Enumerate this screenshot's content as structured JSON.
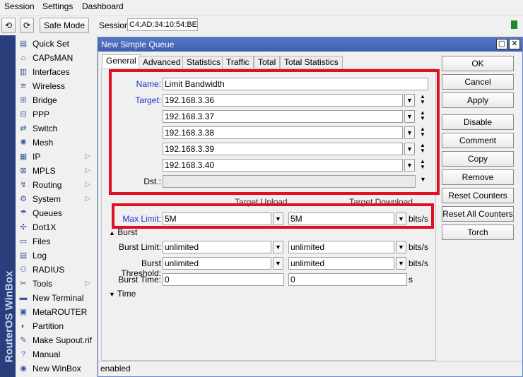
{
  "menubar": {
    "items": [
      "Session",
      "Settings",
      "Dashboard"
    ]
  },
  "toolbar": {
    "undo": "⟲",
    "redo": "⟳",
    "safe_mode": "Safe Mode",
    "session_label": "Session:",
    "session_value": "C4:AD:34:10:54:BE"
  },
  "brand": "RouterOS WinBox",
  "sidebar": {
    "items": [
      {
        "label": "Quick Set",
        "icon": "quick-set-icon"
      },
      {
        "label": "CAPsMAN",
        "icon": "capsman-icon"
      },
      {
        "label": "Interfaces",
        "icon": "interfaces-icon"
      },
      {
        "label": "Wireless",
        "icon": "wireless-icon"
      },
      {
        "label": "Bridge",
        "icon": "bridge-icon"
      },
      {
        "label": "PPP",
        "icon": "ppp-icon"
      },
      {
        "label": "Switch",
        "icon": "switch-icon"
      },
      {
        "label": "Mesh",
        "icon": "mesh-icon"
      },
      {
        "label": "IP",
        "icon": "ip-icon",
        "submenu": true
      },
      {
        "label": "MPLS",
        "icon": "mpls-icon",
        "submenu": true
      },
      {
        "label": "Routing",
        "icon": "routing-icon",
        "submenu": true
      },
      {
        "label": "System",
        "icon": "system-icon",
        "submenu": true
      },
      {
        "label": "Queues",
        "icon": "queues-icon"
      },
      {
        "label": "Dot1X",
        "icon": "dot1x-icon"
      },
      {
        "label": "Files",
        "icon": "files-icon"
      },
      {
        "label": "Log",
        "icon": "log-icon"
      },
      {
        "label": "RADIUS",
        "icon": "radius-icon"
      },
      {
        "label": "Tools",
        "icon": "tools-icon",
        "submenu": true
      },
      {
        "label": "New Terminal",
        "icon": "terminal-icon"
      },
      {
        "label": "MetaROUTER",
        "icon": "metarouter-icon"
      },
      {
        "label": "Partition",
        "icon": "partition-icon"
      },
      {
        "label": "Make Supout.rif",
        "icon": "supout-icon"
      },
      {
        "label": "Manual",
        "icon": "manual-icon"
      },
      {
        "label": "New WinBox",
        "icon": "winbox-icon"
      }
    ]
  },
  "window": {
    "title": "New Simple Queue",
    "tabs": [
      "General",
      "Advanced",
      "Statistics",
      "Traffic",
      "Total",
      "Total Statistics"
    ],
    "general": {
      "name_label": "Name:",
      "name_value": "Limit Bandwidth",
      "target_label": "Target:",
      "targets": [
        "192.168.3.36",
        "192.168.3.37",
        "192.168.3.38",
        "192.168.3.39",
        "192.168.3.40"
      ],
      "dst_label": "Dst.:",
      "dst_value": "",
      "target_upload_header": "Target Upload",
      "target_download_header": "Target Download",
      "max_limit_label": "Max Limit:",
      "max_limit_upload": "5M",
      "max_limit_download": "5M",
      "unit_bits": "bits/s",
      "unit_s": "s",
      "burst_section": "Burst",
      "burst_limit_label": "Burst Limit:",
      "burst_limit_upload": "unlimited",
      "burst_limit_download": "unlimited",
      "burst_threshold_label": "Burst Threshold:",
      "burst_threshold_upload": "unlimited",
      "burst_threshold_download": "unlimited",
      "burst_time_label": "Burst Time:",
      "burst_time_upload": "0",
      "burst_time_download": "0",
      "time_section": "Time"
    },
    "buttons": [
      "OK",
      "Cancel",
      "Apply",
      "Disable",
      "Comment",
      "Copy",
      "Remove",
      "Reset Counters",
      "Reset All Counters",
      "Torch"
    ],
    "status": "enabled"
  },
  "colors": {
    "highlight": "#e01020",
    "title_bar": "#4a6bbb",
    "sidebar_strip": "#2a3e7e",
    "field_label_blue": "#1d2fc8"
  }
}
